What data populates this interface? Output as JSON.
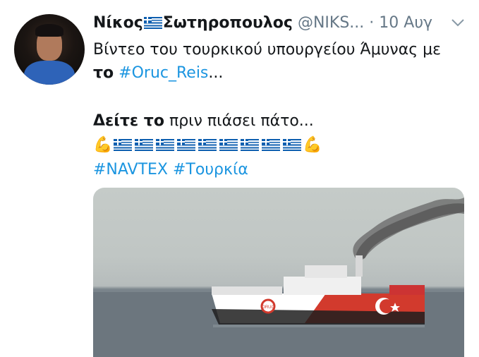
{
  "tweet": {
    "author_name_part1": "Νίκος",
    "author_name_part2": "Σωτηροπουλος",
    "handle": "@NIKS...",
    "separator": "·",
    "date": "10 Αυγ",
    "text_line1": "Βίντεο του τουρκικού υπουργείου Άμυνας με",
    "line2_bold": "το",
    "line2_hashtag": "#Oruc_Reis",
    "line2_trail": "...",
    "line3_bold": "Δείτε το",
    "line3_rest": " πριν πιάσει πάτο...",
    "emoji_line": {
      "start": "💪",
      "flag_count": 9,
      "end": "💪"
    },
    "hashtag1": "#NAVTEX",
    "hashtag2": "#Τουρκία",
    "ship_marking": "ORUÇ"
  },
  "colors": {
    "link": "#1b95e0",
    "meta": "#657786",
    "flag_blue": "#0d5eaf"
  },
  "icons": [
    "avatar",
    "greek-flag-icon",
    "chevron-down-icon",
    "flexed-biceps-icon"
  ]
}
